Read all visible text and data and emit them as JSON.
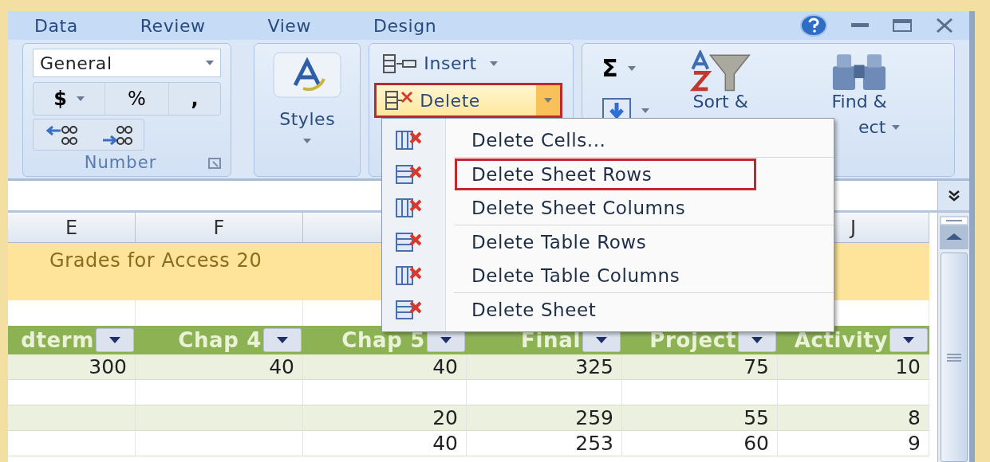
{
  "tabs": [
    {
      "label": "Data"
    },
    {
      "label": "Review"
    },
    {
      "label": "View"
    },
    {
      "label": "Design"
    }
  ],
  "ribbon": {
    "number_group": {
      "format": "General",
      "currency": "$",
      "percent": "%",
      "comma": ",",
      "label": "Number"
    },
    "styles_group": {
      "label": "Styles"
    },
    "cells_group": {
      "insert": "Insert",
      "delete": {
        "label": "Delete",
        "highlighted": true
      }
    },
    "editing_group": {
      "sum": "Σ",
      "sort_label": "Sort &",
      "find_label": "Find &",
      "find_label_end": "ect"
    }
  },
  "menu": {
    "groups": [
      [
        {
          "label": "Delete Cells...",
          "highlighted": false
        }
      ],
      [
        {
          "label": "Delete Sheet Rows",
          "highlighted": true
        },
        {
          "label": "Delete Sheet Columns",
          "highlighted": false
        }
      ],
      [
        {
          "label": "Delete Table Rows",
          "highlighted": false
        },
        {
          "label": "Delete Table Columns",
          "highlighted": false
        }
      ],
      [
        {
          "label": "Delete Sheet",
          "highlighted": false
        }
      ]
    ]
  },
  "sheet": {
    "columns": [
      {
        "letter": "E"
      },
      {
        "letter": "F"
      },
      {},
      {},
      {},
      {
        "letter": "J"
      }
    ],
    "title": "Grades for Access 20",
    "headers": [
      "dterm",
      "Chap 4",
      "Chap 5",
      "Final",
      "Project",
      "Activity"
    ],
    "rows": [
      {
        "cells": [
          "300",
          "40",
          "40",
          "325",
          "75",
          "10"
        ]
      },
      {
        "cells": []
      },
      {
        "cells": [
          null,
          null,
          "20",
          "259",
          "55",
          "8"
        ]
      },
      {
        "cells": [
          null,
          null,
          "40",
          "253",
          "60",
          "9"
        ]
      }
    ]
  }
}
